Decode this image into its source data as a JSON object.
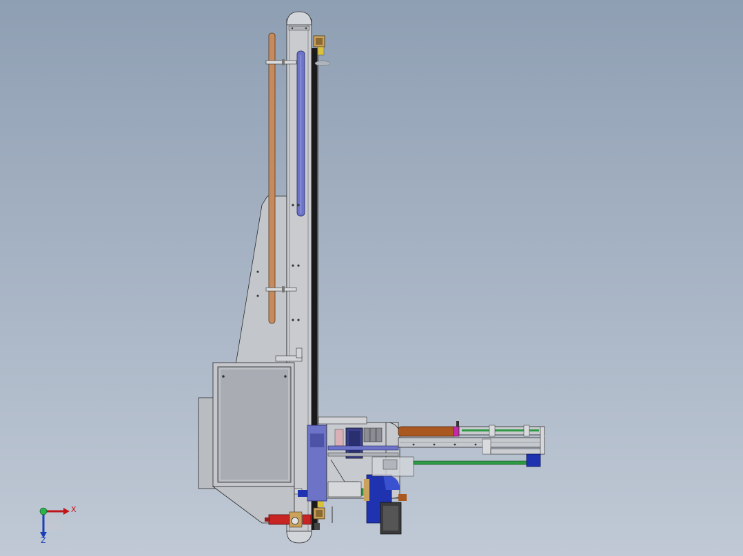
{
  "viewport": {
    "background_top": "#8f9fb3",
    "background_bottom": "#c0c9d5"
  },
  "triad": {
    "x_label": "X",
    "z_label": "Z",
    "x_color": "#c0161b",
    "y_color": "#2cb44b",
    "z_color": "#1c3fb8"
  },
  "colors": {
    "frame": "#c7c9cd",
    "outline": "#2a2a2a",
    "rail_tan": "#c58b5e",
    "cylinder_blue": "#6d74c7",
    "cabinet": "#b8bcc2",
    "drive_blue": "#1f33b0",
    "guide_green": "#2e9a45",
    "brown_cylinder": "#a9581f",
    "brass": "#caa25c",
    "red_valve": "#c82424",
    "magenta": "#c22aa8"
  }
}
